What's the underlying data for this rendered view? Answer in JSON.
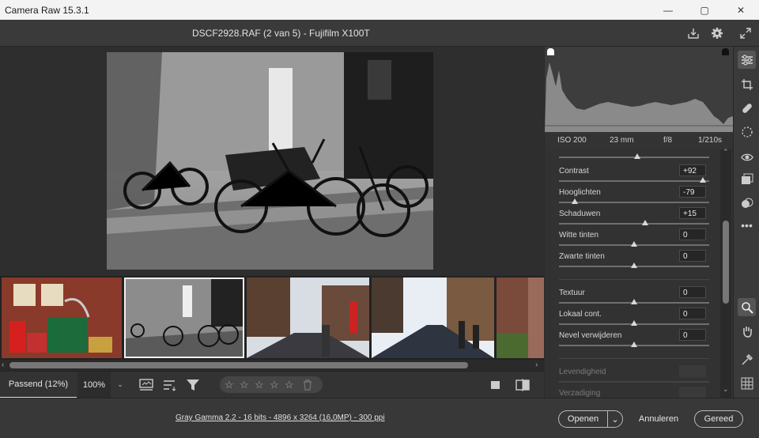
{
  "window": {
    "title": "Camera Raw 15.3.1",
    "minimize": "—",
    "maximize": "▢",
    "close": "✕"
  },
  "header": {
    "file_info": "DSCF2928.RAF (2 van 5)  -  Fujifilm X100T"
  },
  "metadata": {
    "iso": "ISO 200",
    "focal": "23 mm",
    "aperture": "f/8",
    "shutter": "1/210s"
  },
  "sliders": [
    {
      "label": "Contrast",
      "value": "+92",
      "level": 0.96
    },
    {
      "label": "Hooglichten",
      "value": "-79",
      "level": 0.105
    },
    {
      "label": "Schaduwen",
      "value": "+15",
      "level": 0.575
    },
    {
      "label": "Witte tinten",
      "value": "0",
      "level": 0.5
    },
    {
      "label": "Zwarte tinten",
      "value": "0",
      "level": 0.5
    },
    {
      "label": "Textuur",
      "value": "0",
      "level": 0.5
    },
    {
      "label": "Lokaal cont.",
      "value": "0",
      "level": 0.5
    },
    {
      "label": "Nevel verwijderen",
      "value": "0",
      "level": 0.5
    },
    {
      "label": "Levendigheid",
      "value": "",
      "level": 0.5
    },
    {
      "label": "Verzadiging",
      "value": "",
      "level": 0.5
    }
  ],
  "toolbar": {
    "zoom_fit": "Passend (12%)",
    "zoom_100": "100%",
    "stars": [
      "☆",
      "☆",
      "☆",
      "☆",
      "☆"
    ]
  },
  "footer": {
    "info_link": "Gray Gamma 2.2 - 16 bits - 4896 x 3264 (16,0MP) - 300 ppi",
    "open": "Openen",
    "cancel": "Annuleren",
    "done": "Gereed"
  },
  "colors": {
    "accent": "#ffffff",
    "panel": "#323232",
    "rail": "#3a3a3a"
  }
}
